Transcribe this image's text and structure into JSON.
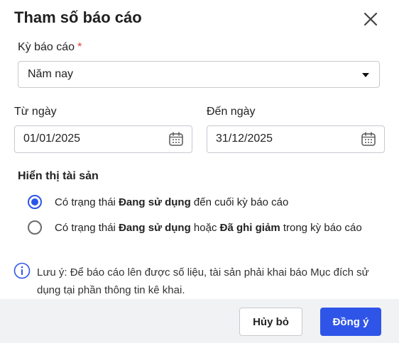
{
  "dialog": {
    "title": "Tham số báo cáo"
  },
  "period": {
    "label": "Kỳ báo cáo",
    "required_mark": "*",
    "selected": "Năm nay"
  },
  "from_date": {
    "label": "Từ ngày",
    "value": "01/01/2025"
  },
  "to_date": {
    "label": "Đến ngày",
    "value": "31/12/2025"
  },
  "display_assets": {
    "heading": "Hiển thị tài sản",
    "options": [
      {
        "selected": true,
        "prefix": "Có trạng thái ",
        "bold1": "Đang sử dụng",
        "suffix1": " đến cuối kỳ báo cáo"
      },
      {
        "selected": false,
        "prefix": "Có trạng thái ",
        "bold1": "Đang sử dụng",
        "middle": " hoặc ",
        "bold2": "Đã ghi giảm",
        "suffix": " trong kỳ báo cáo"
      }
    ]
  },
  "note": {
    "text": "Lưu ý: Để báo cáo lên được số liệu, tài sản phải khai báo Mục đích sử dụng tại phần thông tin kê khai."
  },
  "footer": {
    "cancel_label": "Hủy bỏ",
    "ok_label": "Đồng ý"
  },
  "colors": {
    "primary": "#2f55e8",
    "required": "#e53935",
    "footer_bg": "#f1f2f4"
  },
  "icons": {
    "close": "close-icon",
    "dropdown": "caret-down-icon",
    "calendar": "calendar-icon",
    "info": "info-icon"
  }
}
